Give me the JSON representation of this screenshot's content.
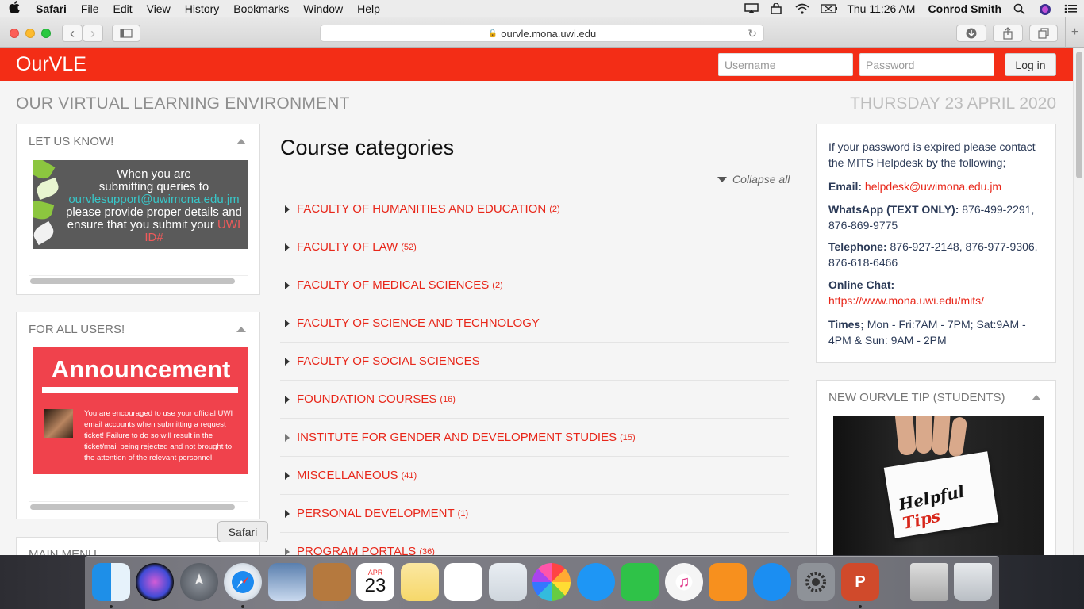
{
  "menubar": {
    "apple": "",
    "items": [
      "Safari",
      "File",
      "Edit",
      "View",
      "History",
      "Bookmarks",
      "Window",
      "Help"
    ],
    "clock": "Thu 11:26 AM",
    "user": "Conrod Smith"
  },
  "browser": {
    "url": "ourvle.mona.uwi.edu",
    "lock_icon": "🔒",
    "reload_icon": "↻",
    "back_icon": "‹",
    "forward_icon": "›",
    "new_tab": "+"
  },
  "site": {
    "brand": "OurVLE",
    "username_placeholder": "Username",
    "password_placeholder": "Password",
    "login_label": "Log in",
    "page_heading": "OUR VIRTUAL LEARNING ENVIRONMENT",
    "date": "THURSDAY 23 APRIL 2020",
    "accent": "#f32d16"
  },
  "left_blocks": {
    "letusknow": {
      "title": "LET US KNOW!",
      "line1": "When you are",
      "line2": "submitting queries to",
      "email": "ourvlesupport@uwimona.edu.jm",
      "line3": "please provide proper details and",
      "line4a": "ensure that you submit your ",
      "line4b": "UWI",
      "line5": "ID#"
    },
    "forallusers": {
      "title": "FOR ALL USERS!",
      "headline": "Announcement",
      "body": "You are encouraged to use your official UWI email accounts when submitting a request ticket! Failure to do so will result in the ticket/mail being rejected and not brought to the attention of the relevant personnel."
    },
    "mainmenu": {
      "title": "MAIN MENU"
    }
  },
  "main": {
    "title": "Course categories",
    "collapse_all": "Collapse all",
    "categories": [
      {
        "name": "FACULTY OF HUMANITIES AND EDUCATION",
        "count": "(2)"
      },
      {
        "name": "FACULTY OF LAW",
        "count": "(52)"
      },
      {
        "name": "FACULTY OF MEDICAL SCIENCES",
        "count": "(2)"
      },
      {
        "name": "FACULTY OF SCIENCE AND TECHNOLOGY",
        "count": ""
      },
      {
        "name": "FACULTY OF SOCIAL SCIENCES",
        "count": ""
      },
      {
        "name": "FOUNDATION COURSES",
        "count": "(16)"
      },
      {
        "name": "INSTITUTE FOR GENDER AND DEVELOPMENT STUDIES",
        "count": "(15)"
      },
      {
        "name": "MISCELLANEOUS",
        "count": "(41)"
      },
      {
        "name": "PERSONAL DEVELOPMENT",
        "count": "(1)"
      },
      {
        "name": "PROGRAM PORTALS",
        "count": "(36)"
      }
    ]
  },
  "helpdesk": {
    "intro": "If your password is expired please contact the MITS Helpdesk by the following;",
    "email_label": "Email:",
    "email_value": "helpdesk@uwimona.edu.jm",
    "whatsapp_label": "WhatsApp (TEXT ONLY):",
    "whatsapp_value": "876-499-2291, 876-869-9775",
    "telephone_label": "Telephone:",
    "telephone_value": "876-927-2148, 876-977-9306, 876-618-6466",
    "chat_label": "Online Chat:",
    "chat_value": "https://www.mona.uwi.edu/mits/",
    "times_label": "Times;",
    "times_value": "Mon - Fri:7AM - 7PM; Sat:9AM - 4PM & Sun: 9AM - 2PM"
  },
  "tip": {
    "title": "NEW OURVLE TIP (STUDENTS)",
    "card_word1": "Helpful",
    "card_word2": "Tips"
  },
  "tooltip": "Safari",
  "dock": {
    "calendar_month": "APR",
    "calendar_day": "23"
  }
}
